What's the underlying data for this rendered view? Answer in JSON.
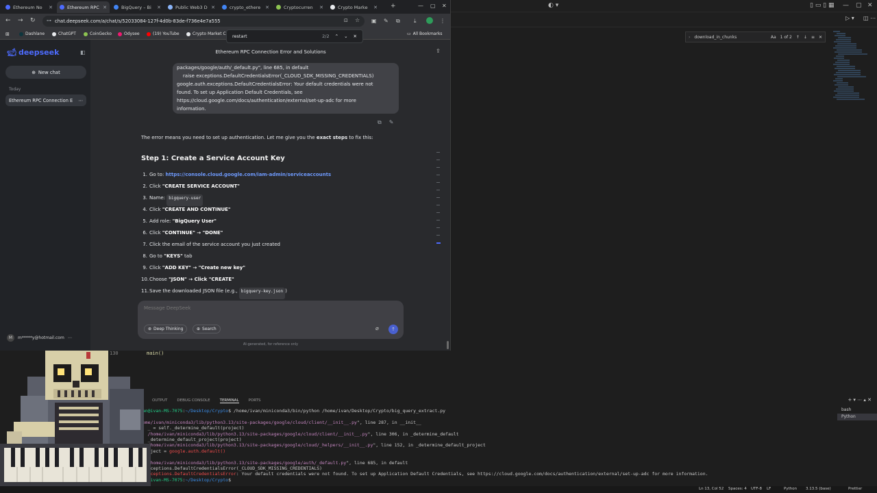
{
  "chrome": {
    "tabs": [
      {
        "label": "Ethereum No",
        "color": "#4d6bfe",
        "active": false
      },
      {
        "label": "Ethereum RPC",
        "color": "#4d6bfe",
        "active": true
      },
      {
        "label": "BigQuery – Bi",
        "color": "#4285f4",
        "active": false
      },
      {
        "label": "Public Web3 D",
        "color": "#8ab4f8",
        "active": false
      },
      {
        "label": "crypto_ethere",
        "color": "#4285f4",
        "active": false
      },
      {
        "label": "Cryptocurren",
        "color": "#8dc351",
        "active": false
      },
      {
        "label": "Crypto Marke",
        "color": "#e8eaed",
        "active": false
      }
    ],
    "url": "chat.deepseek.com/a/chat/s/52033084-127f-4d0b-83de-f736e4e7a555",
    "bookmarks": [
      {
        "label": "Dashlane",
        "color": "#0e353d"
      },
      {
        "label": "ChatGPT",
        "color": "#e8eaed"
      },
      {
        "label": "CoinGecko",
        "color": "#8dc351"
      },
      {
        "label": "Odysee",
        "color": "#ef1970"
      },
      {
        "label": "(19) YouTube",
        "color": "#ff0000"
      },
      {
        "label": "Crypto Market C",
        "color": "#e8eaed"
      }
    ],
    "all_bookmarks": "All Bookmarks",
    "find": {
      "query": "restart",
      "count": "2/2"
    }
  },
  "deepseek": {
    "brand": "deepseek",
    "new_chat": "New chat",
    "today_label": "Today",
    "conversation": "Ethereum RPC Connection E",
    "user_email": "m*****y@hotmail.com",
    "user_initial": "M",
    "chat_title": "Ethereum RPC Connection Error and Solutions",
    "user_message": [
      "packages/google/auth/_default.py\", line 685, in default",
      "    raise exceptions.DefaultCredentialsError(_CLOUD_SDK_MISSING_CREDENTIALS)",
      "google.auth.exceptions.DefaultCredentialsError: Your default credentials were not",
      "found. To set up Application Default Credentials, see",
      "https://cloud.google.com/docs/authentication/external/set-up-adc for more",
      "information."
    ],
    "answer_intro_pre": "The error means you need to set up authentication. Let me give you the ",
    "answer_intro_bold": "exact steps",
    "answer_intro_post": " to fix this:",
    "step_heading": "Step 1: Create a Service Account Key",
    "steps": [
      {
        "num": "1.",
        "pre": "Go to: ",
        "link": "https://console.cloud.google.com/iam-admin/serviceaccounts"
      },
      {
        "num": "2.",
        "pre": "Click ",
        "bold": "\"CREATE SERVICE ACCOUNT\""
      },
      {
        "num": "3.",
        "pre": "Name: ",
        "code": "bigquery-user"
      },
      {
        "num": "4.",
        "pre": "Click ",
        "bold": "\"CREATE AND CONTINUE\""
      },
      {
        "num": "5.",
        "pre": "Add role: ",
        "bold": "\"BigQuery User\""
      },
      {
        "num": "6.",
        "pre": "Click ",
        "bold": "\"CONTINUE\" → \"DONE\""
      },
      {
        "num": "7.",
        "pre": "Click the email of the service account you just created"
      },
      {
        "num": "8.",
        "pre": "Go to ",
        "bold": "\"KEYS\"",
        "post": " tab"
      },
      {
        "num": "9.",
        "pre": "Click ",
        "bold": "\"ADD KEY\" → \"Create new key\""
      },
      {
        "num": "10.",
        "pre": "Choose ",
        "bold": "\"JSON\" → Click \"CREATE\""
      },
      {
        "num": "11.",
        "pre": "Save the downloaded JSON file (e.g., ",
        "code": "bigquery-key.json",
        "post": ")"
      }
    ],
    "composer_placeholder": "Message DeepSeek",
    "deep_thinking": "Deep Thinking",
    "search": "Search",
    "disclaimer": "AI-generated, for reference only"
  },
  "vscode": {
    "find_query": "download_in_chunks",
    "find_count": "1 of 2",
    "find_case": "Aa",
    "line_number": "130",
    "line_code": "main()",
    "panel_tabs": [
      "OUTPUT",
      "DEBUG CONSOLE",
      "TERMINAL",
      "PORTS"
    ],
    "terminal_lines": [
      {
        "cls": "",
        "parts": [
          {
            "c": "p",
            "t": "ivan@ivan-MS-7075"
          },
          {
            "c": "",
            "t": ":"
          },
          {
            "c": "d",
            "t": "~/Desktop/Crypto"
          },
          {
            "c": "",
            "t": "$ /home/ivan/miniconda3/bin/python /home/ivan/Desktop/Crypto/big_query_extract.py"
          }
        ]
      },
      {
        "cls": "",
        "parts": [
          {
            "c": "",
            "t": " "
          }
        ]
      },
      {
        "cls": "",
        "parts": [
          {
            "c": "m",
            "t": "/home/ivan/miniconda3/lib/python3.13/site-packages/google/cloud/client/__init__.py"
          },
          {
            "c": "",
            "t": "\", line 287, in __init__"
          }
        ]
      },
      {
        "cls": "",
        "parts": [
          {
            "c": "",
            "t": "    _ = self._determine_default(project)"
          }
        ]
      },
      {
        "cls": "",
        "parts": [
          {
            "c": "m",
            "t": "    /home/ivan/miniconda3/lib/python3.13/site-packages/google/cloud/client/__init__.py"
          },
          {
            "c": "",
            "t": "\", line 306, in _determine_default"
          }
        ]
      },
      {
        "cls": "",
        "parts": [
          {
            "c": "",
            "t": "    _determine_default_project(project)"
          }
        ]
      },
      {
        "cls": "",
        "parts": [
          {
            "c": "m",
            "t": "    /home/ivan/miniconda3/lib/python3.13/site-packages/google/cloud/_helpers/__init__.py"
          },
          {
            "c": "",
            "t": "\", line 152, in _determine_default_project"
          }
        ]
      },
      {
        "cls": "",
        "parts": [
          {
            "c": "",
            "t": "  project = "
          },
          {
            "c": "r",
            "t": "google.auth.default()"
          }
        ]
      },
      {
        "cls": "",
        "parts": [
          {
            "c": "",
            "t": " "
          }
        ]
      },
      {
        "cls": "",
        "parts": [
          {
            "c": "m",
            "t": "    /home/ivan/miniconda3/lib/python3.13/site-packages/google/auth/_default.py"
          },
          {
            "c": "",
            "t": "\", line 685, in default"
          }
        ]
      },
      {
        "cls": "",
        "parts": [
          {
            "c": "",
            "t": "   exceptions.DefaultCredentialsError(_CLOUD_SDK_MISSING_CREDENTIALS)"
          }
        ]
      },
      {
        "cls": "",
        "parts": [
          {
            "c": "r",
            "t": "   exceptions.DefaultCredentialsError"
          },
          {
            "c": "",
            "t": ": Your default credentials were not found. To set up Application Default Credentials, see https://cloud.google.com/docs/authentication/external/set-up-adc for more information."
          }
        ]
      },
      {
        "cls": "",
        "parts": [
          {
            "c": "p",
            "t": "ivan@ivan-MS-7075"
          },
          {
            "c": "",
            "t": ":"
          },
          {
            "c": "d",
            "t": "~/Desktop/Crypto"
          },
          {
            "c": "",
            "t": "$ "
          }
        ]
      }
    ],
    "terminals": [
      "bash",
      "Python"
    ],
    "status": {
      "position": "Ln 13, Col 52",
      "spaces": "Spaces: 4",
      "encoding": "UTF-8",
      "eol": "LF",
      "language": "Python",
      "interpreter": "3.13.5 (base)",
      "prettier": "Prettier"
    }
  },
  "colors": {
    "accent": "#4d6bfe",
    "link": "#6f9bff",
    "terminal_prompt": "#23d18b"
  }
}
